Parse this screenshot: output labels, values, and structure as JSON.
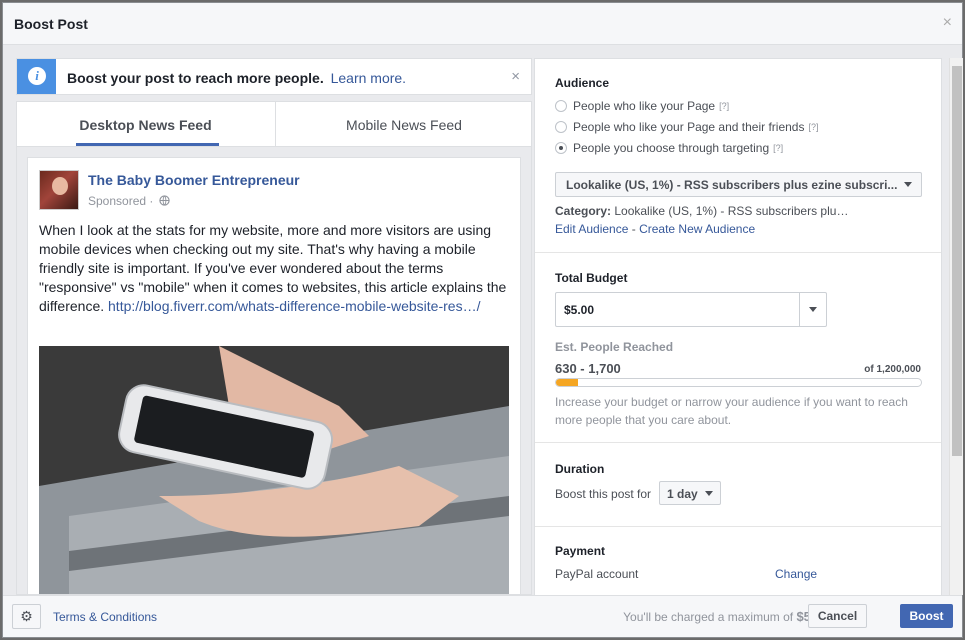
{
  "dialog": {
    "title": "Boost Post",
    "close_icon": "×"
  },
  "banner": {
    "text": "Boost your post to reach more people.",
    "link": "Learn more.",
    "close_icon": "×",
    "icon": "i"
  },
  "tabs": [
    {
      "label": "Desktop News Feed"
    },
    {
      "label": "Mobile News Feed"
    }
  ],
  "post": {
    "page_name": "The Baby Boomer Entrepreneur",
    "sponsored": "Sponsored ·",
    "text": "When I look at the stats for my website, more and more visitors are using mobile devices when checking out my site. That's why having a mobile friendly site is important. If you've ever wondered about the terms \"responsive\" vs \"mobile\" when it comes to websites, this article explains the difference.",
    "link": "http://blog.fiverr.com/whats-difference-mobile-website-res…/"
  },
  "audience": {
    "title": "Audience",
    "options": [
      {
        "label": "People who like your Page",
        "q": "[?]",
        "selected": false
      },
      {
        "label": "People who like your Page and their friends",
        "q": "[?]",
        "selected": false
      },
      {
        "label": "People you choose through targeting",
        "q": "[?]",
        "selected": true
      }
    ],
    "select_value": "Lookalike (US, 1%) - RSS subscribers plus ezine subscri...",
    "category_label": "Category:",
    "category_value": "Lookalike (US, 1%) - RSS subscribers plu…",
    "edit_link": "Edit Audience",
    "sep": " - ",
    "create_link": "Create New Audience"
  },
  "budget": {
    "title": "Total Budget",
    "value": "$5.00",
    "reach_label": "Est. People Reached",
    "reach_value": "630 - 1,700",
    "reach_max": "of 1,200,000",
    "reach_fraction": 0.06,
    "hint": "Increase your budget or narrow your audience if you want to reach more people that you care about."
  },
  "duration": {
    "title": "Duration",
    "label": "Boost this post for",
    "value": "1 day"
  },
  "payment": {
    "title": "Payment",
    "label": "PayPal account",
    "change": "Change"
  },
  "footer": {
    "terms": "Terms & Conditions",
    "charge_text": "You'll be charged a maximum of",
    "charge_amount": "$5.00",
    "cancel": "Cancel",
    "boost": "Boost"
  },
  "colors": {
    "accent": "#4267b2",
    "link": "#365899",
    "reach_bar": "#f5a623"
  }
}
